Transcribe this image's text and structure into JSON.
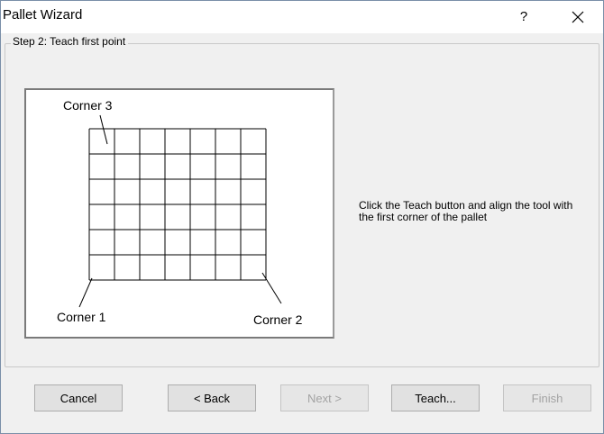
{
  "window": {
    "title": "Pallet Wizard",
    "help_label": "?"
  },
  "step": {
    "group_label": "Step 2: Teach first point",
    "instructions": "Click the Teach button and align the tool with the first corner of the pallet"
  },
  "diagram": {
    "corner3_label": "Corner 3",
    "corner1_label": "Corner 1",
    "corner2_label": "Corner 2",
    "grid_columns": 7,
    "grid_rows": 6
  },
  "buttons": {
    "cancel": "Cancel",
    "back": "< Back",
    "next": "Next >",
    "teach": "Teach...",
    "finish": "Finish"
  },
  "button_states": {
    "next_enabled": false,
    "finish_enabled": false
  }
}
